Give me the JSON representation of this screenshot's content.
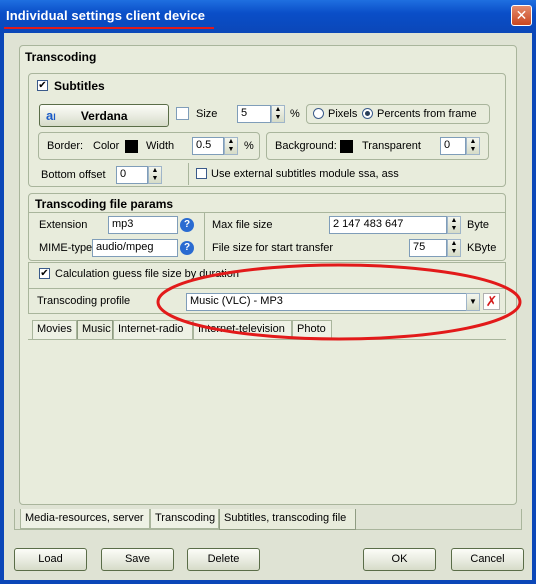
{
  "window": {
    "title": "Individual settings client device",
    "close_label": "✕"
  },
  "transcoding": {
    "header": "Transcoding",
    "subtitles": {
      "header": "Subtitles",
      "font_name": "Verdana",
      "size_label": "Size",
      "size_value": "5",
      "percent_sign": "%",
      "pixels_label": "Pixels",
      "percent_frame_label": "Percents from frame",
      "border_label": "Border:",
      "color_label": "Color",
      "width_label": "Width",
      "width_value": "0.5",
      "width_unit": "%",
      "background_label": "Background:",
      "transparent_label": "Transparent",
      "transparent_value": "0",
      "bottom_offset_label": "Bottom offset",
      "bottom_offset_value": "0",
      "external_label": "Use external subtitles module ssa, ass"
    },
    "file_params": {
      "header": "Transcoding file params",
      "extension_label": "Extension",
      "extension_value": "mp3",
      "mime_label": "MIME-type",
      "mime_value": "audio/mpeg",
      "max_size_label": "Max file size",
      "max_size_value": "2 147 483 647",
      "max_size_unit": "Byte",
      "start_transfer_label": "File size for start transfer",
      "start_transfer_value": "75",
      "start_transfer_unit": "KByte"
    },
    "calc_guess_label": "Calculation guess file size by duration",
    "profile_label": "Transcoding profile",
    "profile_value": "Music (VLC) - MP3",
    "media_tabs": [
      "Movies",
      "Music",
      "Internet-radio",
      "Internet-television",
      "Photo"
    ]
  },
  "bottom_tabs": [
    "Media-resources, server",
    "Transcoding",
    "Subtitles, transcoding file"
  ],
  "buttons": {
    "load": "Load",
    "save": "Save",
    "delete": "Delete",
    "ok": "OK",
    "cancel": "Cancel"
  },
  "colors": {
    "titlebar": "#0b47b8",
    "annotation": "#e21a1a"
  }
}
